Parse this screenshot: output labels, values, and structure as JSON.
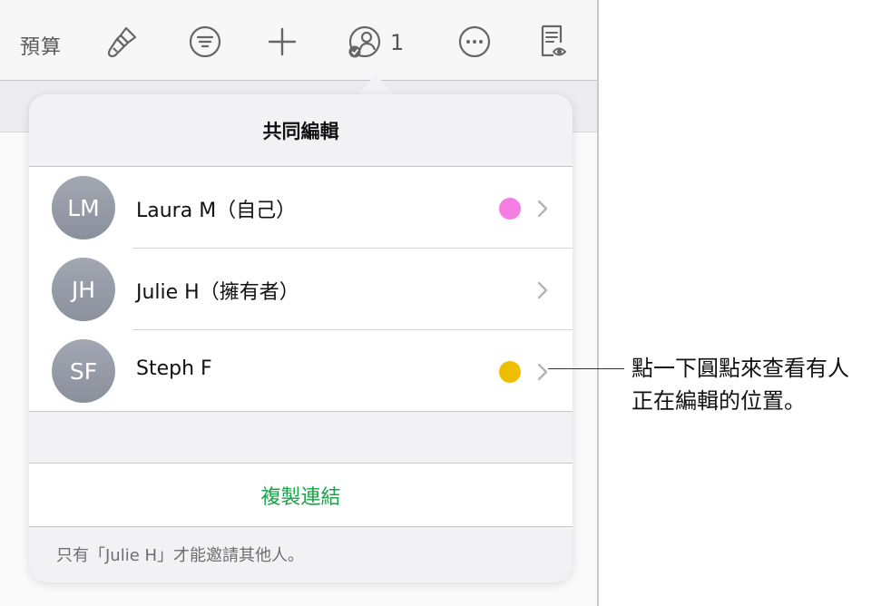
{
  "toolbar": {
    "budget_label": "預算",
    "collab_count": "1",
    "icons": [
      "paintbrush-icon",
      "filter-icon",
      "plus-icon",
      "collaborate-icon",
      "more-icon",
      "reader-view-icon"
    ]
  },
  "popover": {
    "title": "共同編輯",
    "participants": [
      {
        "initials": "LM",
        "name": "Laura M（自己）",
        "dot_color": "#f57de3"
      },
      {
        "initials": "JH",
        "name": "Julie H（擁有者）",
        "dot_color": ""
      },
      {
        "initials": "SF",
        "name": "Steph F",
        "dot_color": "#f0be00"
      }
    ],
    "copy_link": "複製連結",
    "footer_note": "只有「Julie H」才能邀請其他人。"
  },
  "callout": {
    "line1": "點一下圓點來查看有人",
    "line2": "正在編輯的位置。"
  },
  "colors": {
    "accent_green": "#1aa34a"
  }
}
